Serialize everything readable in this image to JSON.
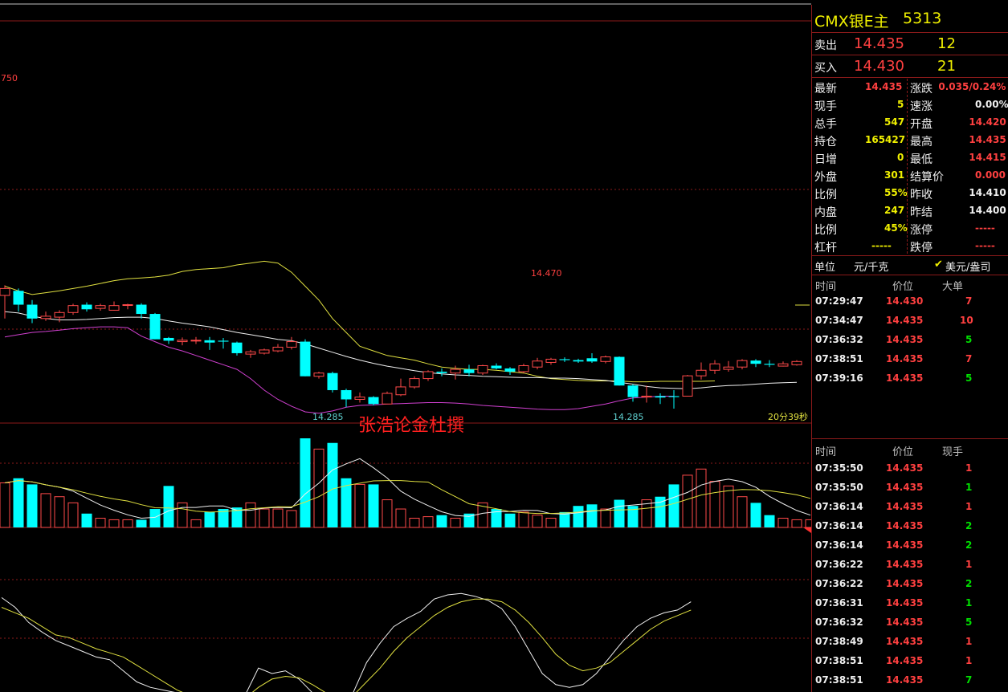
{
  "chart": {
    "high_label": "14.470",
    "left_edge_label": "750",
    "low_label_1": "14.285",
    "low_label_2": "14.285",
    "countdown": "20分39秒",
    "watermark": "张浩论金杜撰"
  },
  "colors": {
    "up": "#ff4a4a",
    "down": "#00ffff",
    "mid": "#f0f0f0",
    "upper": "#e0e040",
    "lower": "#d040d0",
    "grid": "#8b1a1a"
  },
  "quote": {
    "title": "CMX银E主",
    "code": "5313",
    "sell_label": "卖出",
    "sell_price": "14.435",
    "sell_vol": "12",
    "buy_label": "买入",
    "buy_price": "14.430",
    "buy_vol": "21",
    "stats": [
      {
        "l1": "最新",
        "v1": "14.435",
        "c1": "red",
        "l2": "涨跌",
        "v2": "0.035/0.24%",
        "c2": "red"
      },
      {
        "l1": "现手",
        "v1": "5",
        "c1": "yel",
        "l2": "速涨",
        "v2": "0.00%",
        "c2": "wht"
      },
      {
        "l1": "总手",
        "v1": "547",
        "c1": "yel",
        "l2": "开盘",
        "v2": "14.420",
        "c2": "red"
      },
      {
        "l1": "持仓",
        "v1": "165427",
        "c1": "yel",
        "l2": "最高",
        "v2": "14.435",
        "c2": "red"
      },
      {
        "l1": "日增",
        "v1": "0",
        "c1": "yel",
        "l2": "最低",
        "v2": "14.415",
        "c2": "red"
      },
      {
        "l1": "外盘",
        "v1": "301",
        "c1": "yel",
        "l2": "结算价",
        "v2": "0.000",
        "c2": "red"
      },
      {
        "l1": "比例",
        "v1": "55%",
        "c1": "yel",
        "l2": "昨收",
        "v2": "14.410",
        "c2": "wht"
      },
      {
        "l1": "内盘",
        "v1": "247",
        "c1": "yel",
        "l2": "昨结",
        "v2": "14.400",
        "c2": "wht"
      },
      {
        "l1": "比例",
        "v1": "45%",
        "c1": "yel",
        "l2": "涨停",
        "v2": "-----",
        "c2": "red"
      },
      {
        "l1": "杠杆",
        "v1": "-----",
        "c1": "yel",
        "l2": "跌停",
        "v2": "-----",
        "c2": "red"
      }
    ],
    "unit_label": "单位",
    "unit_value": "元/千克",
    "unit_option": "美元/盎司"
  },
  "big_orders": {
    "headers": [
      "时间",
      "价位",
      "大单"
    ],
    "rows": [
      {
        "time": "07:29:47",
        "price": "14.430",
        "vol": "7",
        "vc": "red"
      },
      {
        "time": "07:34:47",
        "price": "14.435",
        "vol": "10",
        "vc": "red"
      },
      {
        "time": "07:36:32",
        "price": "14.435",
        "vol": "5",
        "vc": "grn"
      },
      {
        "time": "07:38:51",
        "price": "14.435",
        "vol": "7",
        "vc": "red"
      },
      {
        "time": "07:39:16",
        "price": "14.435",
        "vol": "5",
        "vc": "grn"
      }
    ]
  },
  "ticks": {
    "headers": [
      "时间",
      "价位",
      "现手"
    ],
    "rows": [
      {
        "time": "07:35:50",
        "price": "14.435",
        "vol": "1",
        "vc": "red"
      },
      {
        "time": "07:35:50",
        "price": "14.435",
        "vol": "1",
        "vc": "grn"
      },
      {
        "time": "07:36:14",
        "price": "14.435",
        "vol": "1",
        "vc": "red"
      },
      {
        "time": "07:36:14",
        "price": "14.435",
        "vol": "2",
        "vc": "grn"
      },
      {
        "time": "07:36:14",
        "price": "14.435",
        "vol": "2",
        "vc": "grn"
      },
      {
        "time": "07:36:22",
        "price": "14.435",
        "vol": "1",
        "vc": "red"
      },
      {
        "time": "07:36:22",
        "price": "14.435",
        "vol": "2",
        "vc": "grn"
      },
      {
        "time": "07:36:31",
        "price": "14.435",
        "vol": "1",
        "vc": "grn"
      },
      {
        "time": "07:36:32",
        "price": "14.435",
        "vol": "5",
        "vc": "grn"
      },
      {
        "time": "07:38:49",
        "price": "14.435",
        "vol": "1",
        "vc": "red"
      },
      {
        "time": "07:38:51",
        "price": "14.435",
        "vol": "1",
        "vc": "red"
      },
      {
        "time": "07:38:51",
        "price": "14.435",
        "vol": "7",
        "vc": "grn"
      }
    ]
  },
  "chart_data": {
    "type": "candlestick",
    "candles": [
      {
        "o": 14.43,
        "h": 14.452,
        "l": 14.38,
        "c": 14.445
      },
      {
        "o": 14.44,
        "h": 14.445,
        "l": 14.395,
        "c": 14.41
      },
      {
        "o": 14.41,
        "h": 14.42,
        "l": 14.37,
        "c": 14.38
      },
      {
        "o": 14.38,
        "h": 14.395,
        "l": 14.375,
        "c": 14.385
      },
      {
        "o": 14.383,
        "h": 14.398,
        "l": 14.372,
        "c": 14.393
      },
      {
        "o": 14.393,
        "h": 14.412,
        "l": 14.388,
        "c": 14.408
      },
      {
        "o": 14.41,
        "h": 14.415,
        "l": 14.395,
        "c": 14.4
      },
      {
        "o": 14.402,
        "h": 14.412,
        "l": 14.397,
        "c": 14.408
      },
      {
        "o": 14.398,
        "h": 14.417,
        "l": 14.397,
        "c": 14.408
      },
      {
        "o": 14.41,
        "h": 14.412,
        "l": 14.4,
        "c": 14.41
      },
      {
        "o": 14.41,
        "h": 14.413,
        "l": 14.38,
        "c": 14.39
      },
      {
        "o": 14.39,
        "h": 14.392,
        "l": 14.335,
        "c": 14.335
      },
      {
        "o": 14.338,
        "h": 14.34,
        "l": 14.325,
        "c": 14.332
      },
      {
        "o": 14.33,
        "h": 14.339,
        "l": 14.322,
        "c": 14.333
      },
      {
        "o": 14.333,
        "h": 14.34,
        "l": 14.325,
        "c": 14.333
      },
      {
        "o": 14.333,
        "h": 14.34,
        "l": 14.312,
        "c": 14.328
      },
      {
        "o": 14.332,
        "h": 14.338,
        "l": 14.315,
        "c": 14.33
      },
      {
        "o": 14.328,
        "h": 14.33,
        "l": 14.3,
        "c": 14.305
      },
      {
        "o": 14.303,
        "h": 14.312,
        "l": 14.295,
        "c": 14.308
      },
      {
        "o": 14.305,
        "h": 14.315,
        "l": 14.302,
        "c": 14.312
      },
      {
        "o": 14.31,
        "h": 14.325,
        "l": 14.307,
        "c": 14.318
      },
      {
        "o": 14.318,
        "h": 14.34,
        "l": 14.313,
        "c": 14.33
      },
      {
        "o": 14.33,
        "h": 14.335,
        "l": 14.255,
        "c": 14.255
      },
      {
        "o": 14.255,
        "h": 14.265,
        "l": 14.25,
        "c": 14.262
      },
      {
        "o": 14.262,
        "h": 14.265,
        "l": 14.22,
        "c": 14.225
      },
      {
        "o": 14.225,
        "h": 14.228,
        "l": 14.188,
        "c": 14.205
      },
      {
        "o": 14.205,
        "h": 14.22,
        "l": 14.198,
        "c": 14.21
      },
      {
        "o": 14.21,
        "h": 14.212,
        "l": 14.192,
        "c": 14.195
      },
      {
        "o": 14.195,
        "h": 14.222,
        "l": 14.195,
        "c": 14.218
      },
      {
        "o": 14.215,
        "h": 14.25,
        "l": 14.212,
        "c": 14.232
      },
      {
        "o": 14.232,
        "h": 14.255,
        "l": 14.228,
        "c": 14.25
      },
      {
        "o": 14.25,
        "h": 14.268,
        "l": 14.245,
        "c": 14.265
      },
      {
        "o": 14.265,
        "h": 14.272,
        "l": 14.255,
        "c": 14.262
      },
      {
        "o": 14.262,
        "h": 14.278,
        "l": 14.248,
        "c": 14.27
      },
      {
        "o": 14.27,
        "h": 14.28,
        "l": 14.255,
        "c": 14.262
      },
      {
        "o": 14.262,
        "h": 14.28,
        "l": 14.258,
        "c": 14.278
      },
      {
        "o": 14.278,
        "h": 14.283,
        "l": 14.27,
        "c": 14.272
      },
      {
        "o": 14.272,
        "h": 14.275,
        "l": 14.258,
        "c": 14.265
      },
      {
        "o": 14.265,
        "h": 14.282,
        "l": 14.262,
        "c": 14.278
      },
      {
        "o": 14.275,
        "h": 14.295,
        "l": 14.27,
        "c": 14.288
      },
      {
        "o": 14.285,
        "h": 14.295,
        "l": 14.28,
        "c": 14.292
      },
      {
        "o": 14.292,
        "h": 14.296,
        "l": 14.286,
        "c": 14.29
      },
      {
        "o": 14.29,
        "h": 14.293,
        "l": 14.284,
        "c": 14.287
      },
      {
        "o": 14.294,
        "h": 14.305,
        "l": 14.284,
        "c": 14.287
      },
      {
        "o": 14.287,
        "h": 14.3,
        "l": 14.283,
        "c": 14.297
      },
      {
        "o": 14.297,
        "h": 14.298,
        "l": 14.235,
        "c": 14.235
      },
      {
        "o": 14.235,
        "h": 14.238,
        "l": 14.2,
        "c": 14.21
      },
      {
        "o": 14.21,
        "h": 14.235,
        "l": 14.198,
        "c": 14.212
      },
      {
        "o": 14.212,
        "h": 14.218,
        "l": 14.195,
        "c": 14.209
      },
      {
        "o": 14.212,
        "h": 14.225,
        "l": 14.185,
        "c": 14.21
      },
      {
        "o": 14.212,
        "h": 14.258,
        "l": 14.212,
        "c": 14.256
      },
      {
        "o": 14.256,
        "h": 14.285,
        "l": 14.248,
        "c": 14.268
      },
      {
        "o": 14.268,
        "h": 14.29,
        "l": 14.26,
        "c": 14.282
      },
      {
        "o": 14.27,
        "h": 14.288,
        "l": 14.265,
        "c": 14.275
      },
      {
        "o": 14.275,
        "h": 14.292,
        "l": 14.27,
        "c": 14.289
      },
      {
        "o": 14.289,
        "h": 14.292,
        "l": 14.275,
        "c": 14.282
      },
      {
        "o": 14.282,
        "h": 14.29,
        "l": 14.275,
        "c": 14.28
      },
      {
        "o": 14.277,
        "h": 14.287,
        "l": 14.276,
        "c": 14.282
      },
      {
        "o": 14.28,
        "h": 14.29,
        "l": 14.278,
        "c": 14.287
      }
    ],
    "volumes": [
      29,
      32,
      28,
      22,
      20,
      16,
      9,
      6,
      5,
      5,
      5,
      12,
      27,
      16,
      5,
      10,
      12,
      13,
      16,
      12,
      12,
      11,
      58,
      51,
      55,
      32,
      28,
      28,
      18,
      12,
      6,
      7,
      8,
      6,
      9,
      16,
      12,
      9,
      10,
      8,
      6,
      10,
      14,
      15,
      12,
      18,
      14,
      18,
      20,
      28,
      34,
      38,
      30,
      27,
      20,
      16,
      8,
      6,
      5,
      5
    ],
    "mid_band": [
      14.395,
      14.392,
      14.385,
      14.38,
      14.377,
      14.377,
      14.378,
      14.38,
      14.382,
      14.383,
      14.383,
      14.38,
      14.375,
      14.37,
      14.366,
      14.362,
      14.356,
      14.35,
      14.345,
      14.34,
      14.335,
      14.332,
      14.325,
      14.316,
      14.307,
      14.298,
      14.29,
      14.283,
      14.277,
      14.272,
      14.267,
      14.263,
      14.26,
      14.258,
      14.257,
      14.255,
      14.254,
      14.253,
      14.252,
      14.252,
      14.251,
      14.251,
      14.25,
      14.248,
      14.246,
      14.242,
      14.238,
      14.233,
      14.23,
      14.229,
      14.228,
      14.23,
      14.233,
      14.235,
      14.236,
      14.238,
      14.24,
      14.241,
      14.242
    ],
    "upper_band": [
      14.45,
      14.44,
      14.432,
      14.436,
      14.44,
      14.445,
      14.45,
      14.456,
      14.462,
      14.466,
      14.468,
      14.47,
      14.474,
      14.482,
      14.486,
      14.488,
      14.49,
      14.496,
      14.5,
      14.504,
      14.5,
      14.48,
      14.45,
      14.42,
      14.38,
      14.35,
      14.32,
      14.31,
      14.3,
      14.295,
      14.29,
      14.282,
      14.275,
      14.272,
      14.27,
      14.27,
      14.268,
      14.265,
      14.262,
      14.255,
      14.25,
      14.248,
      14.246,
      14.245,
      14.245,
      14.245,
      14.243,
      14.243,
      14.244,
      14.244,
      14.244,
      14.244,
      14.245
    ],
    "lower_band": [
      14.34,
      14.345,
      14.35,
      14.352,
      14.355,
      14.358,
      14.36,
      14.362,
      14.362,
      14.36,
      14.342,
      14.33,
      14.318,
      14.31,
      14.3,
      14.29,
      14.28,
      14.27,
      14.25,
      14.225,
      14.205,
      14.19,
      14.178,
      14.175,
      14.18,
      14.188,
      14.192,
      14.193,
      14.195,
      14.196,
      14.197,
      14.198,
      14.198,
      14.197,
      14.195,
      14.192,
      14.19,
      14.188,
      14.186,
      14.184,
      14.183,
      14.183,
      14.185,
      14.19,
      14.195,
      14.202,
      14.208,
      14.21,
      14.212,
      14.212
    ]
  }
}
